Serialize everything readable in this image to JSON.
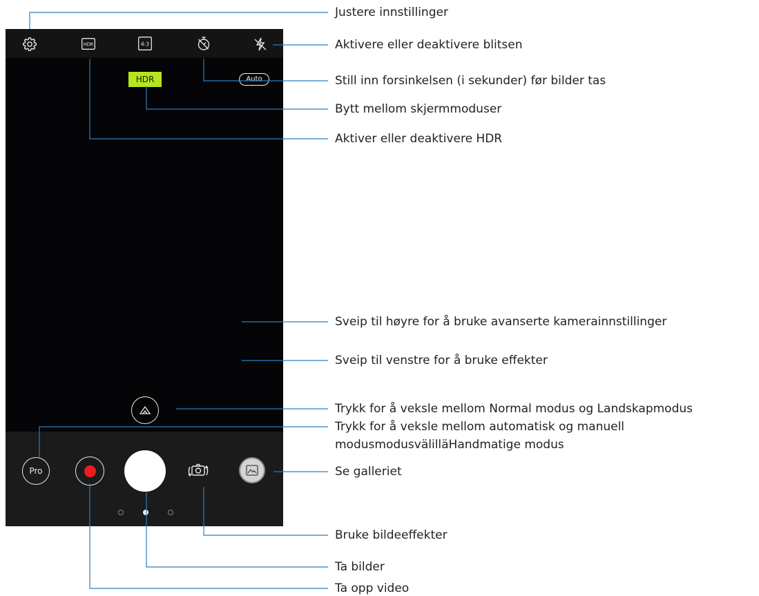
{
  "camera": {
    "top_bar": {
      "hdr_label": "HDR",
      "ratio_label": "4:3"
    },
    "hdr_indicator": "HDR",
    "timer_indicator": "Auto",
    "pro_label": "Pro",
    "colors": {
      "hdr_chip": "#b5e61d",
      "record_dot": "#ee1c1c",
      "topbar": "#141414",
      "bottombar": "#1b1b1b"
    }
  },
  "callouts": [
    "Justere innstillinger",
    "Aktivere eller deaktivere blitsen",
    "Still inn forsinkelsen (i sekunder) før bilder tas",
    "Bytt mellom skjermmoduser",
    "Aktiver eller deaktivere HDR",
    "Sveip til høyre for å bruke avanserte kamerainnstillinger",
    "Sveip til venstre for å bruke effekter",
    "Trykk for å veksle mellom Normal modus og Landskapmodus",
    "Trykk for å veksle mellom automatisk og manuell",
    "modusmodusvälilläHandmatige modus",
    "Se galleriet",
    "Bruke bildeeffekter",
    "Ta bilder",
    "Ta opp video"
  ]
}
